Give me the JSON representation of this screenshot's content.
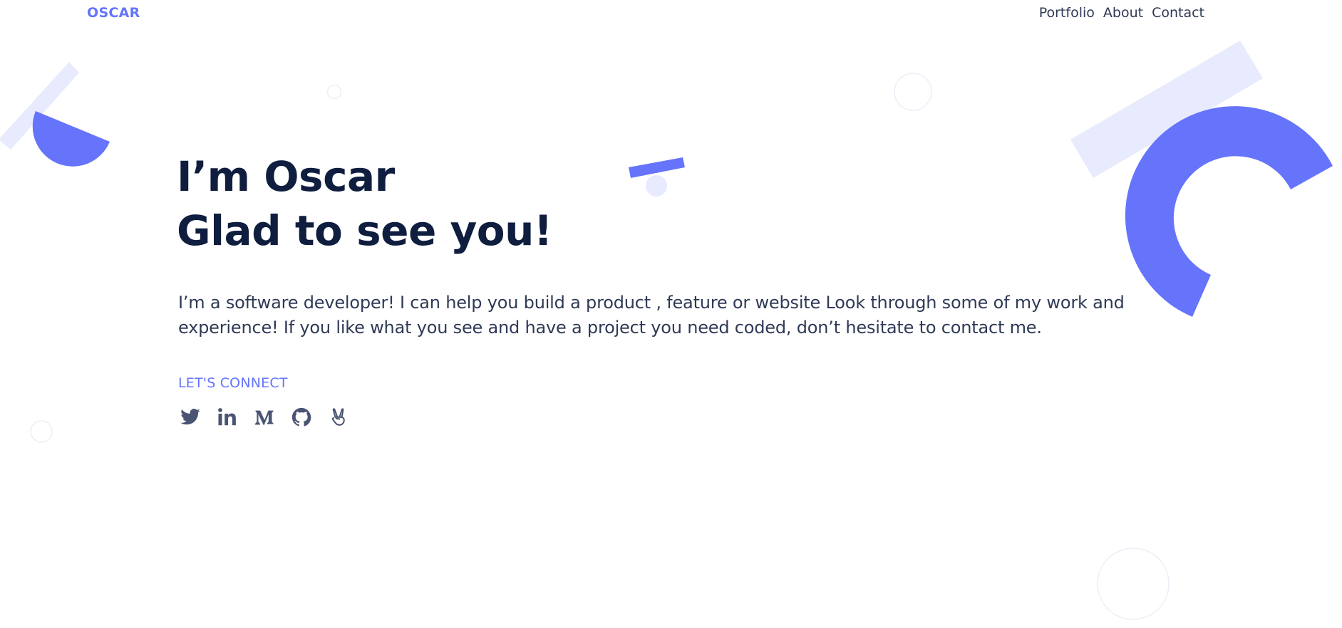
{
  "header": {
    "logo": "OSCAR",
    "nav": [
      {
        "label": "Portfolio"
      },
      {
        "label": "About"
      },
      {
        "label": "Contact"
      }
    ]
  },
  "hero": {
    "title_line1": "I’m Oscar",
    "title_line2": "Glad to see you!",
    "intro": "I’m a software developer! I can help you build a product , feature or website Look through some of my work and experience! If you like what you see and have a project you need coded, don’t hesitate to contact me."
  },
  "connect": {
    "heading": "LET'S CONNECT",
    "socials": [
      {
        "icon": "twitter-icon"
      },
      {
        "icon": "linkedin-icon"
      },
      {
        "icon": "medium-icon"
      },
      {
        "icon": "github-icon"
      },
      {
        "icon": "angellist-icon"
      }
    ]
  },
  "colors": {
    "accent": "#6574fb",
    "accent_light": "#e8eafd",
    "heading": "#0f1d3f",
    "text": "#2f3a56",
    "icon": "#4a5473"
  }
}
